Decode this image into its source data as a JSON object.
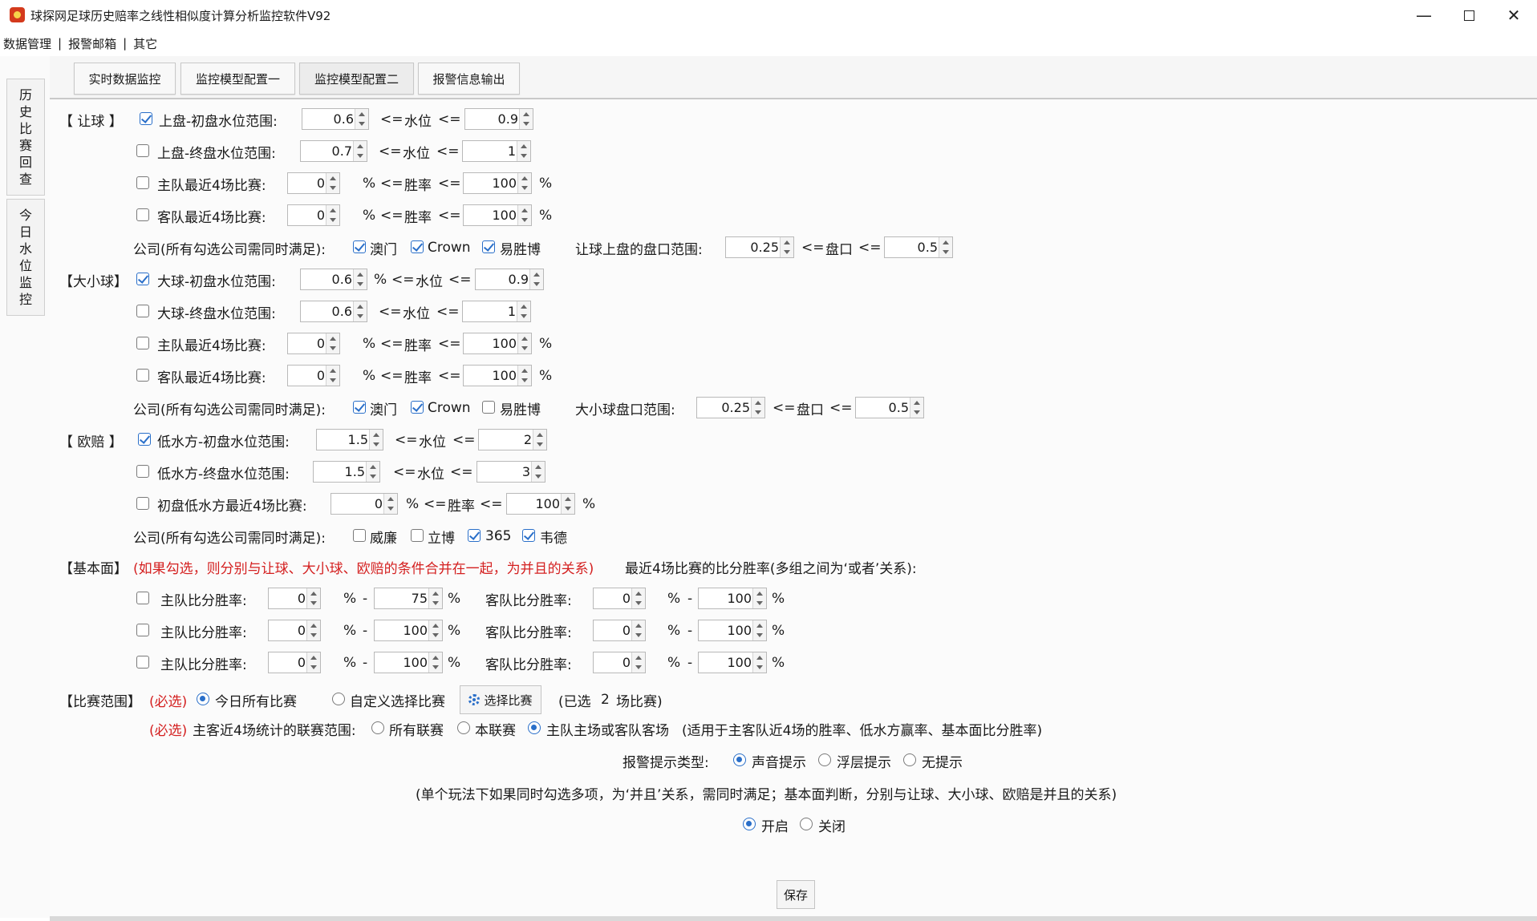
{
  "window": {
    "title": "球探网足球历史赔率之线性相似度计算分析监控软件V92"
  },
  "menu": [
    "数据管理",
    "报警邮箱",
    "其它"
  ],
  "menu_sep": "|",
  "side_tabs": [
    {
      "chars": [
        "历",
        "史",
        "比",
        "赛",
        "回",
        "查"
      ]
    },
    {
      "chars": [
        "今",
        "日",
        "水",
        "位",
        "监",
        "控"
      ]
    }
  ],
  "tabs": [
    "实时数据监控",
    "监控模型配置一",
    "监控模型配置二",
    "报警信息输出"
  ],
  "sym": {
    "le": "<=",
    "pct": "%",
    "dash": "-"
  },
  "w": {
    "water": "水位",
    "win": "胜率",
    "pan": "盘口"
  },
  "rq": {
    "label": "【  让球  】",
    "r1": {
      "label": "上盘-初盘水位范围:",
      "min": "0.6",
      "max": "0.9"
    },
    "r2": {
      "label": "上盘-终盘水位范围:",
      "min": "0.7",
      "max": "1"
    },
    "r3": {
      "label": "主队最近4场比赛:",
      "min": "0",
      "max": "100"
    },
    "r4": {
      "label": "客队最近4场比赛:",
      "min": "0",
      "max": "100"
    },
    "company_label": "公司(所有勾选公司需同时满足):",
    "companies": [
      "澳门",
      "Crown",
      "易胜博"
    ],
    "range_label": "让球上盘的盘口范围:",
    "range_min": "0.25",
    "range_max": "0.5"
  },
  "dx": {
    "label": "【大小球】",
    "r1": {
      "label": "大球-初盘水位范围:",
      "min": "0.6",
      "max": "0.9"
    },
    "r2": {
      "label": "大球-终盘水位范围:",
      "min": "0.6",
      "max": "1"
    },
    "r3": {
      "label": "主队最近4场比赛:",
      "min": "0",
      "max": "100"
    },
    "r4": {
      "label": "客队最近4场比赛:",
      "min": "0",
      "max": "100"
    },
    "company_label": "公司(所有勾选公司需同时满足):",
    "companies": [
      "澳门",
      "Crown",
      "易胜博"
    ],
    "range_label": "大小球盘口范围:",
    "range_min": "0.25",
    "range_max": "0.5"
  },
  "op": {
    "label": "【  欧赔  】",
    "r1": {
      "label": "低水方-初盘水位范围:",
      "min": "1.5",
      "max": "2"
    },
    "r2": {
      "label": "低水方-终盘水位范围:",
      "min": "1.5",
      "max": "3"
    },
    "r3": {
      "label": "初盘低水方最近4场比赛:",
      "min": "0",
      "max": "100"
    },
    "company_label": "公司(所有勾选公司需同时满足):",
    "companies": [
      "威廉",
      "立博",
      "365",
      "韦德"
    ]
  },
  "jb": {
    "label": "【基本面】",
    "note": "(如果勾选，则分别与让球、大小球、欧赔的条件合并在一起，为并且的关系)",
    "desc": "最近4场比赛的比分胜率(多组之间为‘或者’关系):",
    "home_label": "主队比分胜率:",
    "away_label": "客队比分胜率:",
    "rows": [
      {
        "home_min": "0",
        "home_max": "75",
        "away_min": "0",
        "away_max": "100"
      },
      {
        "home_min": "0",
        "home_max": "100",
        "away_min": "0",
        "away_max": "100"
      },
      {
        "home_min": "0",
        "home_max": "100",
        "away_min": "0",
        "away_max": "100"
      }
    ]
  },
  "scope": {
    "label": "【比赛范围】",
    "required": "(必选)",
    "opt_all": "今日所有比赛",
    "opt_custom": "自定义选择比赛",
    "select_btn": "选择比赛",
    "selected_prefix": "(已选",
    "selected_count": "2",
    "selected_suffix": "场比赛)",
    "league_required": "(必选)",
    "league_label": "主客近4场统计的联赛范围:",
    "league_opts": [
      "所有联赛",
      "本联赛",
      "主队主场或客队客场"
    ],
    "league_note": "(适用于主客队近4场的胜率、低水方赢率、基本面比分胜率)"
  },
  "alarm": {
    "label": "报警提示类型:",
    "opts": [
      "声音提示",
      "浮层提示",
      "无提示"
    ]
  },
  "note": "(单个玩法下如果同时勾选多项，为‘并且’关系，需同时满足；基本面判断，分别与让球、大小球、欧赔是并且的关系)",
  "switch": {
    "on": "开启",
    "off": "关闭"
  },
  "save": "保存"
}
